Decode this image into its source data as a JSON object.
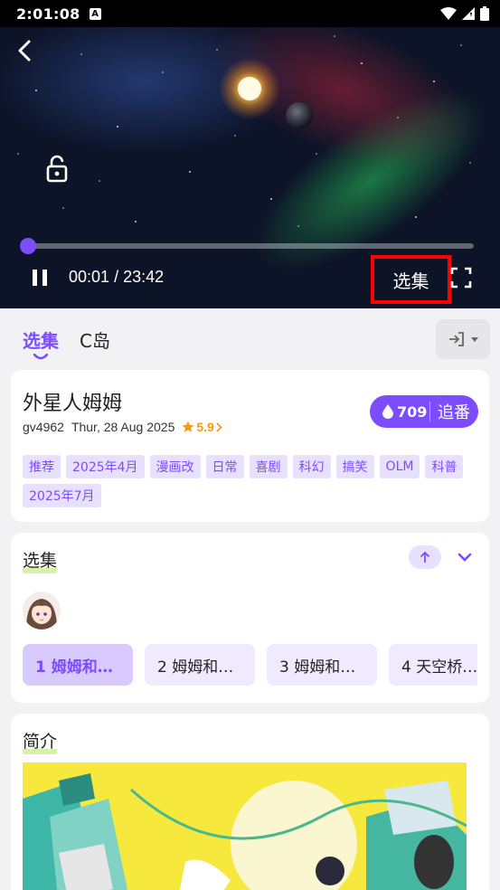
{
  "status_bar": {
    "time": "2:01:08",
    "badge": "A"
  },
  "player": {
    "current_time": "00:01",
    "separator": "/",
    "duration": "23:42",
    "progress": 0.01,
    "episodes_button_label": "选集"
  },
  "tabs": [
    {
      "label": "选集",
      "active": true
    },
    {
      "label": "C岛",
      "active": false
    }
  ],
  "info": {
    "title": "外星人姆姆",
    "id": "gv4962",
    "date": "Thur, 28 Aug 2025",
    "rating": "5.9",
    "follow_count": "709",
    "follow_label": "追番",
    "tags": [
      "推荐",
      "2025年4月",
      "漫画改",
      "日常",
      "喜剧",
      "科幻",
      "搞笑",
      "OLM",
      "科普",
      "2025年7月"
    ]
  },
  "episodes": {
    "section_title": "选集",
    "items": [
      {
        "label": "1 姆姆和…",
        "active": true
      },
      {
        "label": "2 姆姆和…",
        "active": false
      },
      {
        "label": "3 姆姆和…",
        "active": false
      },
      {
        "label": "4 天空桥…",
        "active": false
      }
    ]
  },
  "intro": {
    "section_title": "简介"
  },
  "colors": {
    "accent": "#7c4dff",
    "highlight": "#ff0000",
    "rating": "#f39c12"
  }
}
